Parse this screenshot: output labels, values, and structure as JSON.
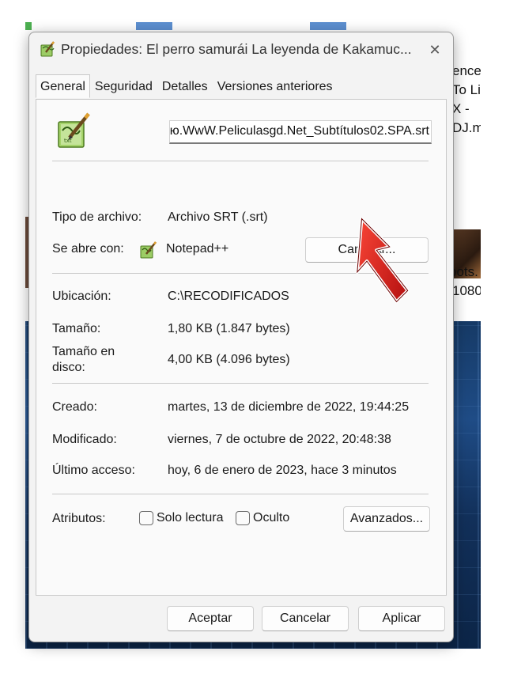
{
  "background": {
    "text_fragments": [
      "ence",
      "To Li",
      "X -",
      "DJ.m",
      "pots.",
      "1080"
    ]
  },
  "dialog": {
    "title": "Propiedades: El perro samurái La leyenda de Kakamuc...",
    "close_glyph": "✕"
  },
  "tabs": [
    {
      "label": "General",
      "active": true
    },
    {
      "label": "Seguridad",
      "active": false
    },
    {
      "label": "Detalles",
      "active": false
    },
    {
      "label": "Versiones anteriores",
      "active": false
    }
  ],
  "general": {
    "filename": "WwW.Peliculasgd.Net_Subtítulos02.SPA.srt",
    "filename_visible_prefix": "ю.",
    "tipo_label": "Tipo de archivo:",
    "tipo_value": "Archivo SRT (.srt)",
    "abre_label": "Se abre con:",
    "abre_value": "Notepad++",
    "cambiar_label": "Cambiar...",
    "ubicacion_label": "Ubicación:",
    "ubicacion_value": "C:\\RECODIFICADOS",
    "tamano_label": "Tamaño:",
    "tamano_value": "1,80 KB (1.847 bytes)",
    "tamano_disco_label_1": "Tamaño en",
    "tamano_disco_label_2": "disco:",
    "tamano_disco_value": "4,00 KB (4.096 bytes)",
    "creado_label": "Creado:",
    "creado_value": "martes, 13 de diciembre de 2022, 19:44:25",
    "modificado_label": "Modificado:",
    "modificado_value": "viernes, 7 de octubre de 2022, 20:48:38",
    "acceso_label": "Último acceso:",
    "acceso_value": "hoy, 6 de enero de 2023, hace 3 minutos",
    "atributos_label": "Atributos:",
    "solo_lectura_label": "Solo lectura",
    "solo_lectura_checked": false,
    "oculto_label": "Oculto",
    "oculto_checked": false,
    "avanzados_label": "Avanzados..."
  },
  "footer": {
    "aceptar": "Aceptar",
    "cancelar": "Cancelar",
    "aplicar": "Aplicar"
  },
  "colors": {
    "annotation_arrow": "#d01818",
    "notepad_green": "#8bc34a"
  },
  "icons": {
    "title": "notepadpp-file-icon",
    "file": "notepadpp-file-icon",
    "app": "notepadpp-app-icon",
    "annotation": "red-arrow-pointer"
  }
}
